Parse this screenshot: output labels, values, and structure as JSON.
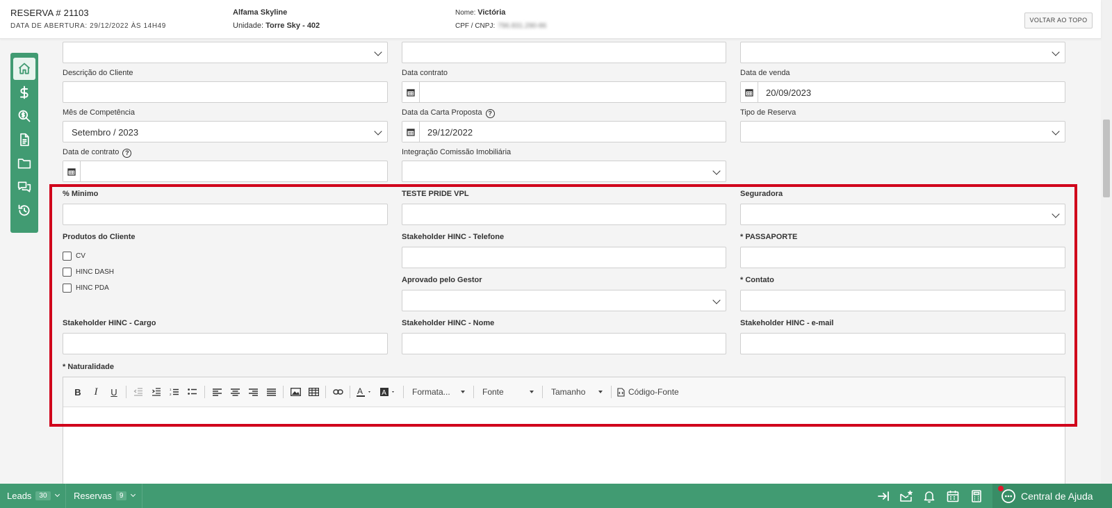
{
  "header": {
    "reservation": "RESERVA # 21103",
    "opening_date": "DATA DE ABERTURA: 29/12/2022 ÀS 14H49",
    "enterprise": "Alfama Skyline",
    "unit_label": "Unidade:",
    "unit_value": "Torre Sky - 402",
    "client_name_label": "Nome:",
    "client_name_value": "Victória",
    "doc_label": "CPF / CNPJ:",
    "doc_value": "796.831.290-86",
    "back_to_top": "VOLTAR AO TOPO"
  },
  "sidebar": {
    "items": [
      {
        "icon": "home-icon",
        "active": true
      },
      {
        "icon": "dollar-icon"
      },
      {
        "icon": "search-dollar-icon"
      },
      {
        "icon": "document-icon"
      },
      {
        "icon": "folder-icon"
      },
      {
        "icon": "chat-icon"
      },
      {
        "icon": "history-icon"
      }
    ]
  },
  "form": {
    "descricao_cliente": {
      "label": "Descrição do Cliente",
      "value": ""
    },
    "data_contrato": {
      "label": "Data contrato",
      "value": ""
    },
    "data_venda": {
      "label": "Data de venda",
      "value": "20/09/2023"
    },
    "mes_competencia": {
      "label": "Mês de Competência",
      "value": "Setembro / 2023"
    },
    "data_carta_proposta": {
      "label": "Data da Carta Proposta",
      "value": "29/12/2022"
    },
    "tipo_reserva": {
      "label": "Tipo de Reserva",
      "value": ""
    },
    "data_de_contrato": {
      "label": "Data de contrato",
      "value": ""
    },
    "integracao_comissao": {
      "label": "Integração Comissão Imobiliária",
      "value": ""
    },
    "percent_minimo": {
      "label": "% Minimo",
      "value": ""
    },
    "teste_pride_vpl": {
      "label": "TESTE PRIDE VPL",
      "value": ""
    },
    "seguradora": {
      "label": "Seguradora",
      "value": ""
    },
    "produtos_cliente": {
      "label": "Produtos do Cliente",
      "options": [
        {
          "label": "CV",
          "checked": false
        },
        {
          "label": "HINC DASH",
          "checked": false
        },
        {
          "label": "HINC PDA",
          "checked": false
        }
      ]
    },
    "stakeholder_telefone": {
      "label": "Stakeholder HINC - Telefone",
      "value": ""
    },
    "passaporte": {
      "label": "* PASSAPORTE",
      "value": ""
    },
    "aprovado_gestor": {
      "label": "Aprovado pelo Gestor",
      "value": ""
    },
    "contato": {
      "label": "* Contato",
      "value": ""
    },
    "stakeholder_cargo": {
      "label": "Stakeholder HINC - Cargo",
      "value": ""
    },
    "stakeholder_nome": {
      "label": "Stakeholder HINC - Nome",
      "value": ""
    },
    "stakeholder_email": {
      "label": "Stakeholder HINC - e-mail",
      "value": ""
    },
    "naturalidade": {
      "label": "* Naturalidade"
    }
  },
  "editor": {
    "format_label": "Formata...",
    "font_label": "Fonte",
    "size_label": "Tamanho",
    "source_label": "Código-Fonte"
  },
  "bottombar": {
    "leads_label": "Leads",
    "leads_count": "30",
    "reservas_label": "Reservas",
    "reservas_count": "9",
    "help_center": "Central de Ajuda"
  },
  "colors": {
    "brand_green": "#419b72",
    "highlight_red": "#d0021b"
  }
}
